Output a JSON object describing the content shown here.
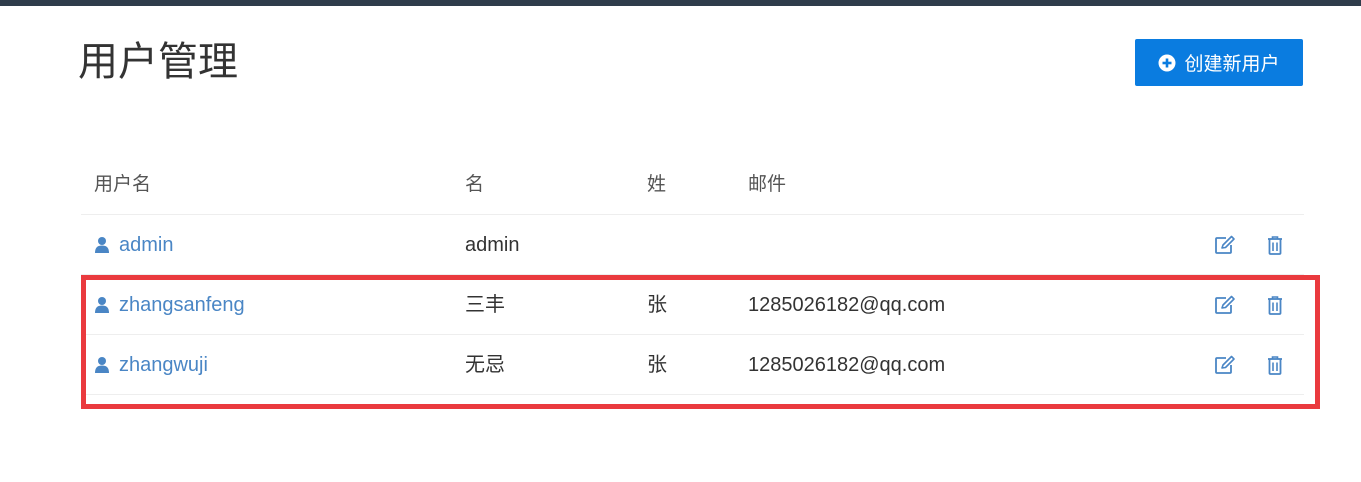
{
  "page": {
    "title": "用户管理",
    "create_button_label": "创建新用户",
    "accent_color": "#0a7ce0",
    "highlight_color": "#ea3a3e"
  },
  "table": {
    "headers": {
      "username": "用户名",
      "first_name": "名",
      "last_name": "姓",
      "email": "邮件"
    },
    "rows": [
      {
        "username": "admin",
        "first_name": "admin",
        "last_name": "",
        "email": ""
      },
      {
        "username": "zhangsanfeng",
        "first_name": "三丰",
        "last_name": "张",
        "email": "1285026182@qq.com"
      },
      {
        "username": "zhangwuji",
        "first_name": "无忌",
        "last_name": "张",
        "email": "1285026182@qq.com"
      }
    ]
  },
  "icons": {
    "user": "user-icon",
    "edit": "edit-icon",
    "delete": "trash-icon",
    "create": "plus-circle-icon"
  }
}
